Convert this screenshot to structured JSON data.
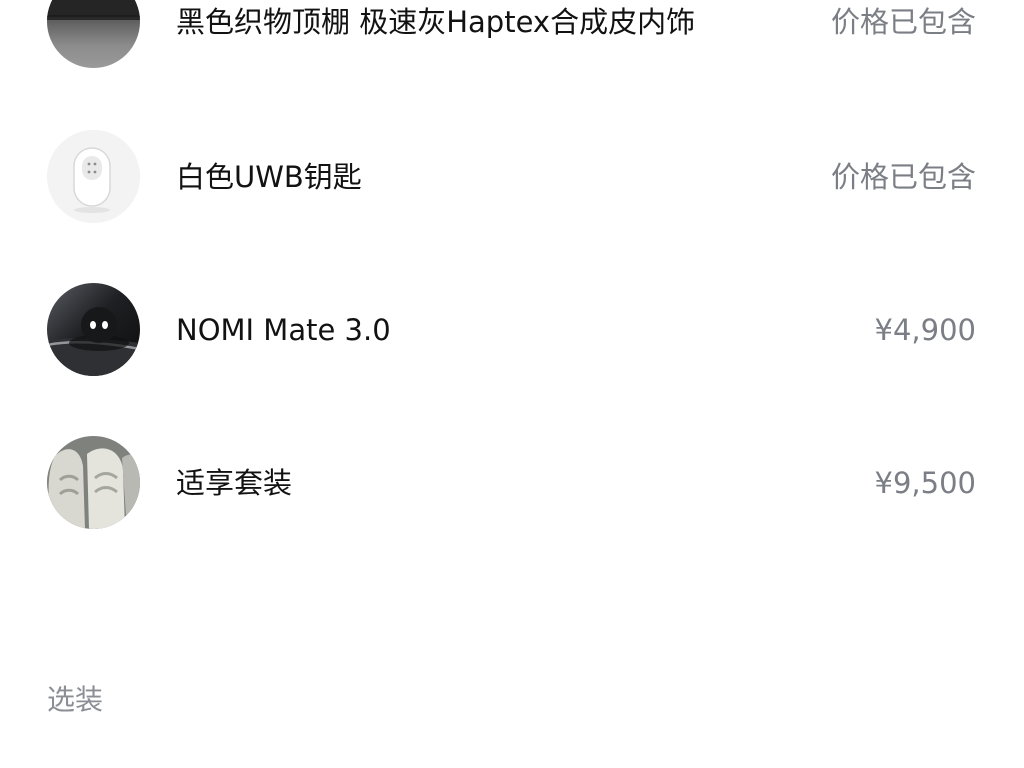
{
  "included_items": [
    {
      "name": "黑色织物顶棚 极速灰Haptex合成皮内饰",
      "price": "价格已包含",
      "thumbnail_icon": "interior-trim-thumbnail"
    },
    {
      "name": "白色UWB钥匙",
      "price": "价格已包含",
      "thumbnail_icon": "uwb-key-thumbnail"
    },
    {
      "name": "NOMI Mate 3.0",
      "price": "¥4,900",
      "thumbnail_icon": "nomi-mate-thumbnail"
    },
    {
      "name": "适享套装",
      "price": "¥9,500",
      "thumbnail_icon": "comfort-seat-package-thumbnail"
    }
  ],
  "optional_section": {
    "label": "选装"
  },
  "colors": {
    "text_primary": "#121212",
    "text_secondary": "#7b7f85",
    "section_label": "#8b8f95",
    "background": "#ffffff"
  }
}
